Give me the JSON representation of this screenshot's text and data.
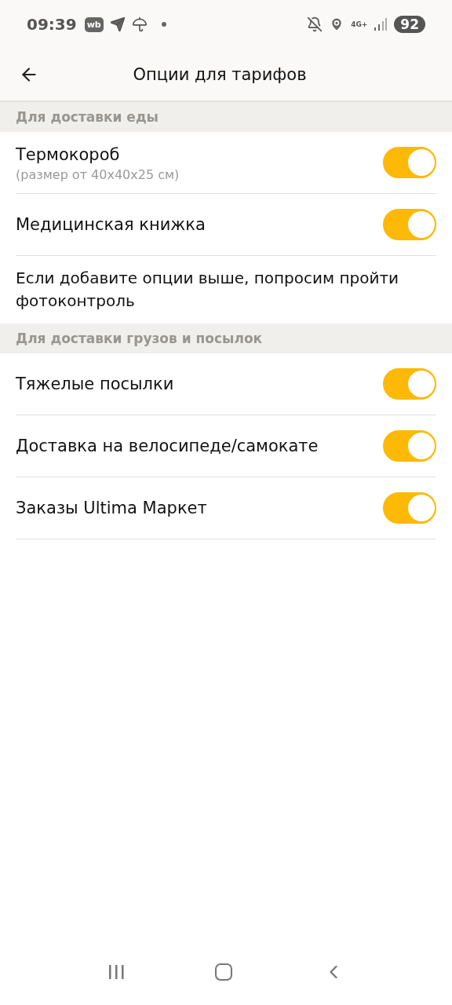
{
  "status_bar": {
    "time": "09:39",
    "app_badge": "wb",
    "network": "4G+",
    "battery": "92"
  },
  "header": {
    "title": "Опции для тарифов"
  },
  "sections": [
    {
      "title": "Для доставки еды",
      "items": [
        {
          "kind": "toggle",
          "label": "Термокороб",
          "sublabel": "(размер от 40x40x25 см)",
          "on": true
        },
        {
          "kind": "toggle",
          "label": "Медицинская книжка",
          "on": true
        },
        {
          "kind": "note",
          "label": "Если добавите опции выше, попросим пройти фотоконтроль"
        }
      ]
    },
    {
      "title": "Для доставки грузов и посылок",
      "items": [
        {
          "kind": "toggle",
          "label": "Тяжелые посылки",
          "on": true
        },
        {
          "kind": "toggle",
          "label": "Доставка на велосипеде/самокате",
          "on": true
        },
        {
          "kind": "toggle",
          "label": "Заказы Ultima Маркет",
          "on": true
        }
      ]
    }
  ]
}
